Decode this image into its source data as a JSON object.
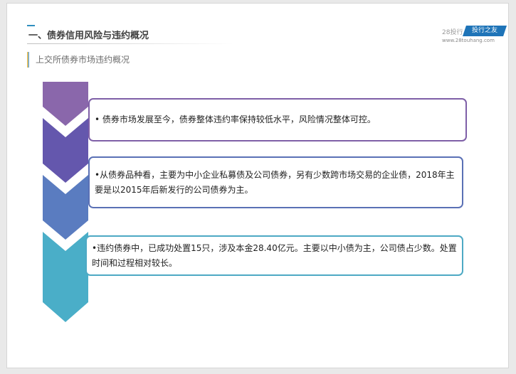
{
  "slide": {
    "title": "一、债券信用风险与违约概况",
    "subtitle": "上交所债券市场违约概况"
  },
  "brand": {
    "prefix": "28投行",
    "badge": "投行之友",
    "url": "www.28touhang.com",
    "badge_color": "#1e74b8"
  },
  "points": [
    {
      "text": "• 债券市场发展至今，债券整体违约率保持较低水平，风险情况整体可控。",
      "color": "#7e5fa7"
    },
    {
      "text": "•从债券品种看，主要为中小企业私募债及公司债券，另有少数跨市场交易的企业债，2018年主要是以2015年后新发行的公司债券为主。",
      "color": "#5a70b5"
    },
    {
      "text": "•违约债券中，已成功处置15只，涉及本金28.40亿元。主要以中小债为主，公司债占少数。处置时间和过程相对较长。",
      "color": "#4da9c4"
    }
  ],
  "chevron_colors": [
    "#8a67ab",
    "#6457ad",
    "#5a7cc0",
    "#4aaec8"
  ]
}
